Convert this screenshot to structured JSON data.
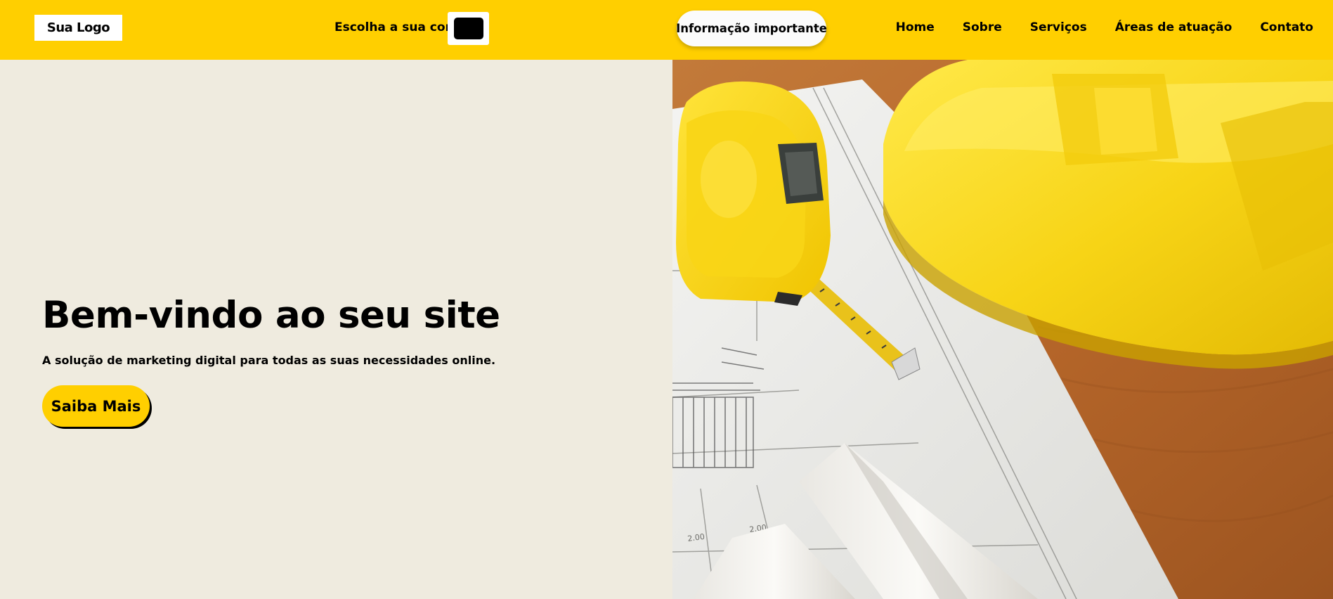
{
  "header": {
    "logo_text": "Sua Logo",
    "color_picker_label": "Escolha a sua cor",
    "color_picker_value": "#000000",
    "info_button_label": "Informação importante",
    "background_color": "#ffcf00"
  },
  "nav": {
    "items": [
      {
        "label": "Home"
      },
      {
        "label": "Sobre"
      },
      {
        "label": "Serviços"
      },
      {
        "label": "Áreas de atuação"
      },
      {
        "label": "Contato"
      }
    ]
  },
  "hero": {
    "title": "Bem-vindo ao seu site",
    "subtitle": "A solução de marketing digital para todas as suas necessidades online.",
    "cta_label": "Saiba Mais",
    "background_color": "#efebdf",
    "image_subject": "construction-tools-photo",
    "image_labels": [
      "2.00",
      "2.00"
    ]
  },
  "colors": {
    "accent": "#ffcf00",
    "text": "#000000"
  }
}
